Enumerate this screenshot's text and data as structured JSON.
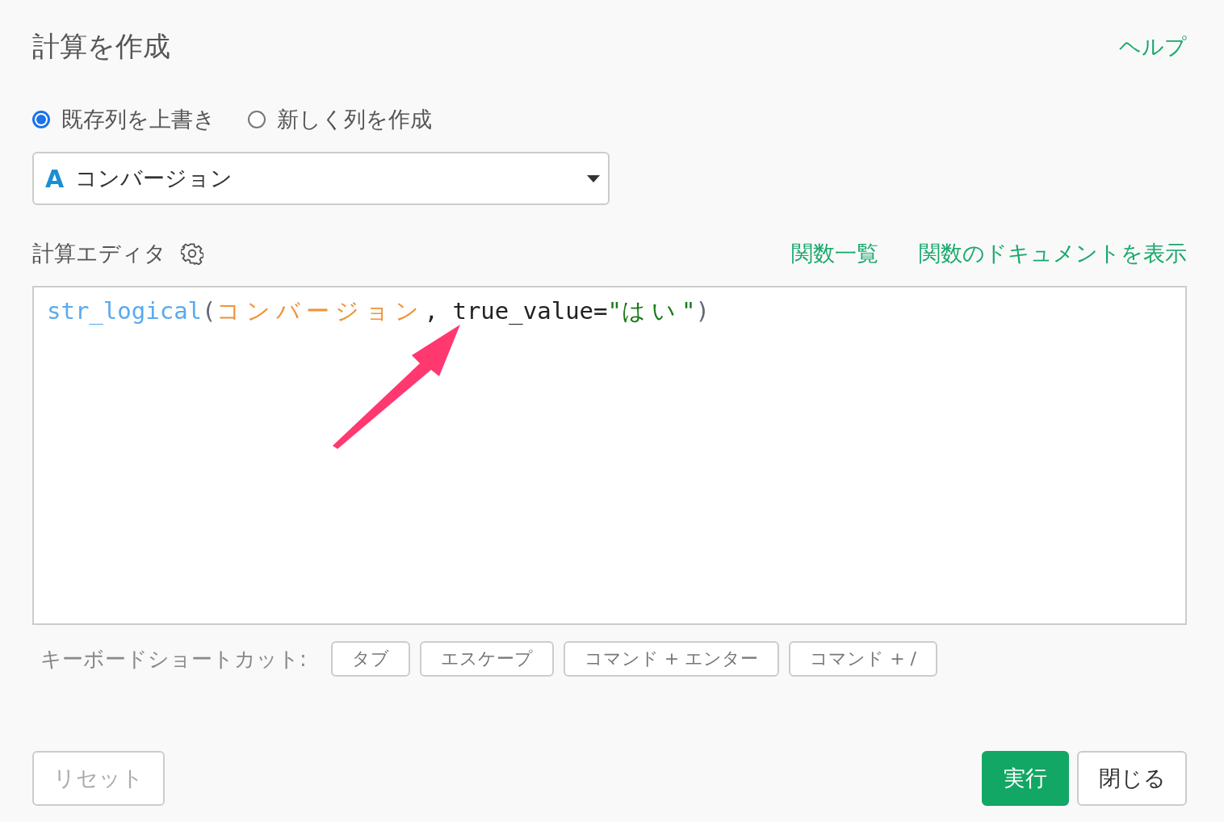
{
  "title": "計算を作成",
  "help_link": "ヘルプ",
  "mode_options": [
    {
      "label": "既存列を上書き",
      "selected": true
    },
    {
      "label": "新しく列を作成",
      "selected": false
    }
  ],
  "column_select": {
    "type_badge": "A",
    "value": "コンバージョン"
  },
  "editor": {
    "label": "計算エディタ",
    "links": [
      "関数一覧",
      "関数のドキュメントを表示"
    ],
    "code": [
      {
        "kind": "function",
        "text": "str_logical"
      },
      {
        "kind": "paren",
        "text": "("
      },
      {
        "kind": "column",
        "text": "コンバージョン"
      },
      {
        "kind": "punct",
        "text": ", true_value="
      },
      {
        "kind": "quote",
        "text": "\""
      },
      {
        "kind": "string",
        "text": "はい"
      },
      {
        "kind": "quote",
        "text": "\""
      },
      {
        "kind": "paren",
        "text": ")"
      }
    ]
  },
  "shortcuts": {
    "label": "キーボードショートカット:",
    "keys": [
      "タブ",
      "エスケープ",
      "コマンド + エンター",
      "コマンド + /"
    ]
  },
  "buttons": {
    "reset": "リセット",
    "run": "実行",
    "close": "閉じる"
  }
}
